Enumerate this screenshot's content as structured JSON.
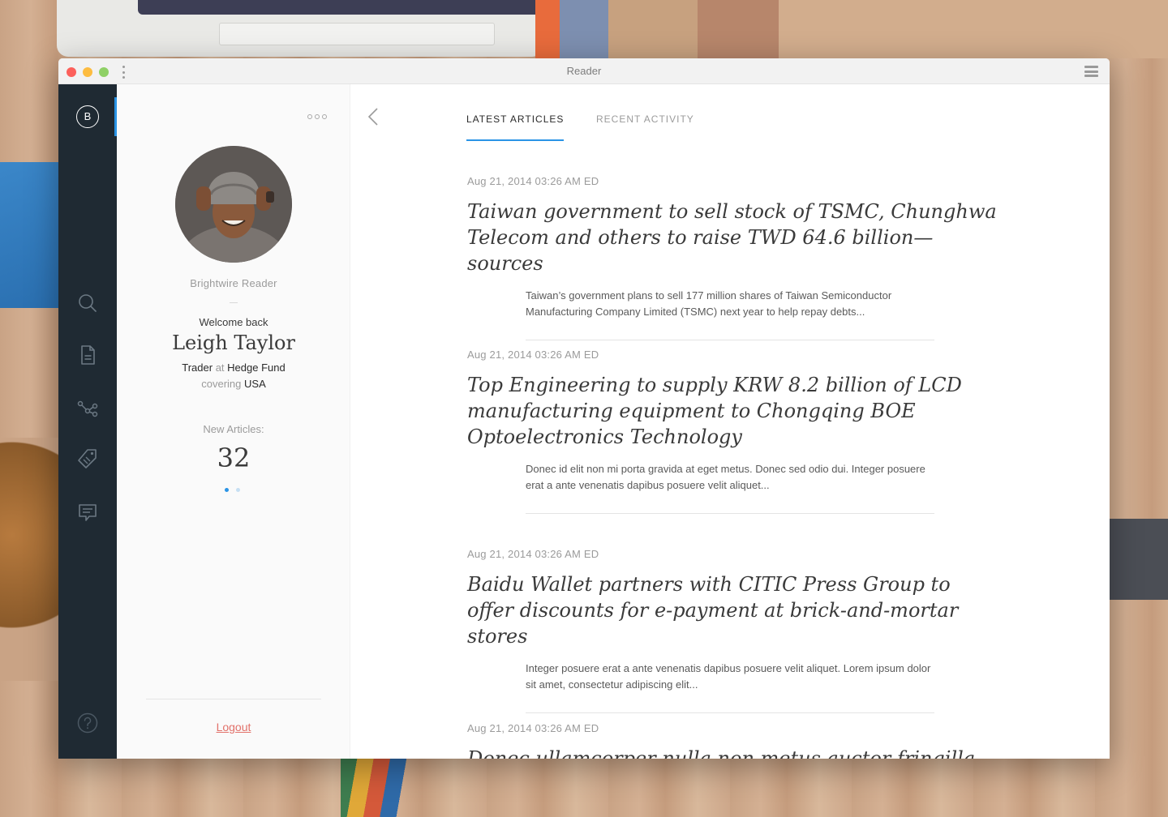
{
  "window": {
    "title": "Reader"
  },
  "nav": {
    "logo_letter": "B",
    "items": [
      {
        "icon": "search-icon"
      },
      {
        "icon": "document-icon"
      },
      {
        "icon": "share-network-icon"
      },
      {
        "icon": "tag-icon"
      },
      {
        "icon": "comment-icon"
      }
    ],
    "help_icon": "help-icon"
  },
  "profile": {
    "app_name": "Brightwire Reader",
    "welcome": "Welcome back",
    "user_name": "Leigh Taylor",
    "role": "Trader",
    "at": "at",
    "company": "Hedge Fund",
    "covering_label": "covering",
    "covering_value": "USA",
    "new_articles_label": "New Articles:",
    "new_articles_count": "32",
    "logout_label": "Logout"
  },
  "tabs": [
    {
      "label": "LATEST ARTICLES",
      "active": true
    },
    {
      "label": "RECENT ACTIVITY",
      "active": false
    }
  ],
  "articles": [
    {
      "date": "Aug 21, 2014 03:26 AM ED",
      "title": "Taiwan government to sell stock of TSMC, Chunghwa Telecom and others to raise TWD 64.6 billion—sources",
      "excerpt": "Taiwan’s government plans to sell 177 million shares of Taiwan Semiconductor Manufacturing Company Limited (TSMC) next year to help repay debts..."
    },
    {
      "date": "Aug 21, 2014 03:26 AM ED",
      "title": "Top Engineering to supply KRW 8.2 billion of LCD manufacturing equipment to Chongqing BOE Optoelectronics Technology",
      "excerpt": "Donec id elit non mi porta gravida at eget metus. Donec sed odio dui. Integer posuere erat a ante venenatis dapibus posuere velit aliquet..."
    },
    {
      "date": "Aug 21, 2014 03:26 AM ED",
      "title": "Baidu Wallet partners with CITIC Press Group to offer discounts for e-payment at brick-and-mortar stores",
      "excerpt": "Integer posuere erat a ante venenatis dapibus posuere velit aliquet. Lorem ipsum dolor sit amet, consectetur adipiscing elit..."
    },
    {
      "date": "Aug 21, 2014 03:26 AM ED",
      "title": "Donec ullamcorper nulla non metus auctor fringilla"
    }
  ],
  "colors": {
    "accent": "#2a94e6",
    "nav_bg": "#1f2a33",
    "logout": "#e2716a"
  }
}
